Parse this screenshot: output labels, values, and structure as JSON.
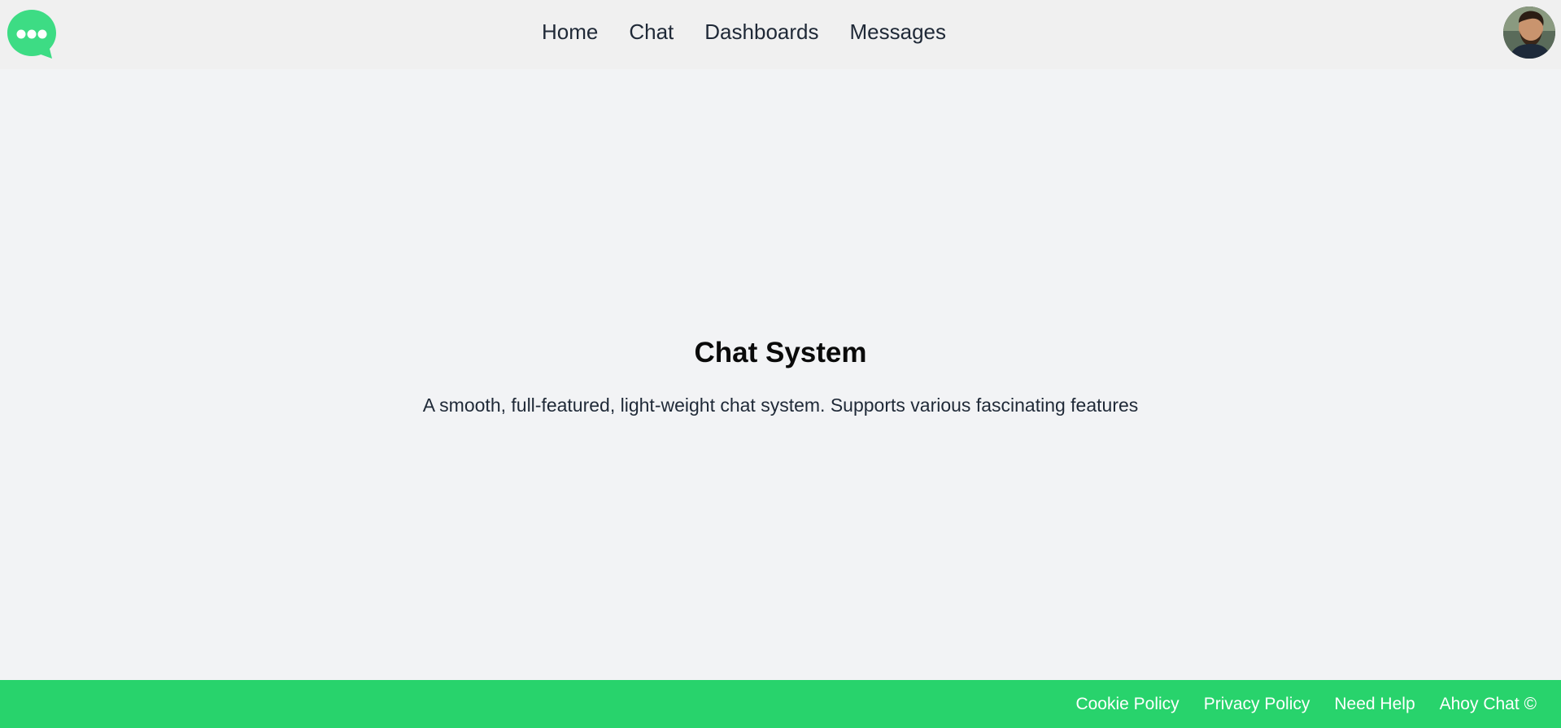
{
  "nav": {
    "logo_icon": "chat-bubble-dots-icon",
    "links": [
      {
        "label": "Home"
      },
      {
        "label": "Chat"
      },
      {
        "label": "Dashboards"
      },
      {
        "label": "Messages"
      }
    ],
    "avatar_icon": "user-avatar"
  },
  "hero": {
    "title": "Chat System",
    "subtitle": "A smooth, full-featured, light-weight chat system. Supports various fascinating features"
  },
  "footer": {
    "links": [
      {
        "label": "Cookie Policy"
      },
      {
        "label": "Privacy Policy"
      },
      {
        "label": "Need Help"
      },
      {
        "label": "Ahoy Chat ©"
      }
    ]
  },
  "colors": {
    "brand": "#28d36c",
    "nav_bg": "#f0f0f0",
    "page_bg": "#f2f3f5"
  }
}
